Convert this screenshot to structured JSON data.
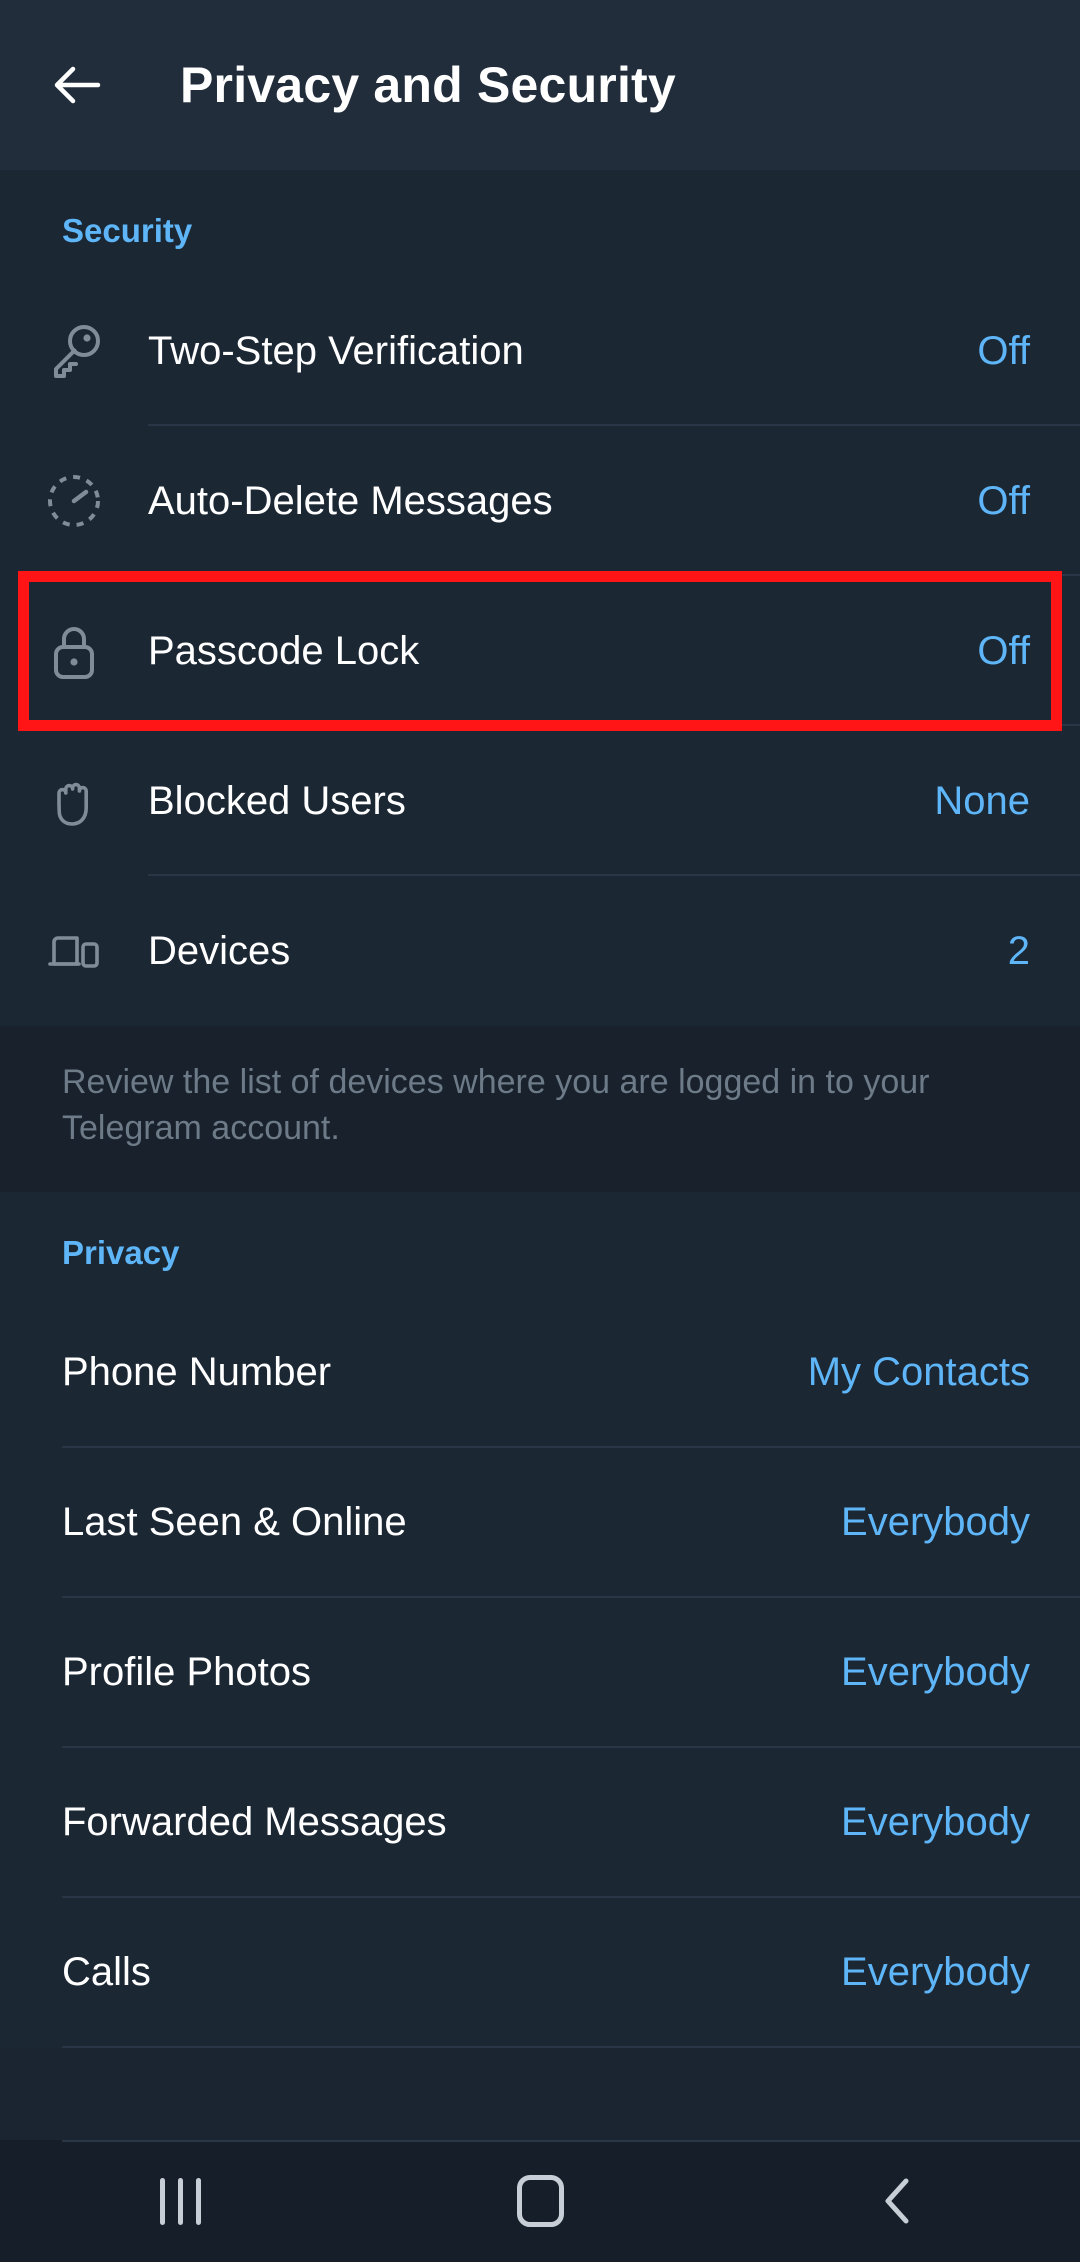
{
  "header": {
    "title": "Privacy and Security",
    "back_icon": "arrow-left-icon"
  },
  "security": {
    "section_title": "Security",
    "items": [
      {
        "label": "Two-Step Verification",
        "value": "Off",
        "icon": "key-icon"
      },
      {
        "label": "Auto-Delete Messages",
        "value": "Off",
        "icon": "timer-icon"
      },
      {
        "label": "Passcode Lock",
        "value": "Off",
        "icon": "lock-icon"
      },
      {
        "label": "Blocked Users",
        "value": "None",
        "icon": "hand-icon"
      },
      {
        "label": "Devices",
        "value": "2",
        "icon": "devices-icon"
      }
    ],
    "note": "Review the list of devices where you are logged in to your Telegram account."
  },
  "privacy": {
    "section_title": "Privacy",
    "items": [
      {
        "label": "Phone Number",
        "value": "My Contacts"
      },
      {
        "label": "Last Seen & Online",
        "value": "Everybody"
      },
      {
        "label": "Profile Photos",
        "value": "Everybody"
      },
      {
        "label": "Forwarded Messages",
        "value": "Everybody"
      },
      {
        "label": "Calls",
        "value": "Everybody"
      }
    ]
  },
  "highlight": {
    "target": "Passcode Lock",
    "color": "#ff1515"
  },
  "navbar": {
    "recents_label": "recents-icon",
    "home_label": "home-icon",
    "back_label": "back-icon"
  },
  "theme": {
    "background": "#1c2734",
    "header_bg": "#222d3c",
    "accent": "#5eb5f7",
    "text": "#ffffff",
    "muted": "#6d7a88"
  }
}
